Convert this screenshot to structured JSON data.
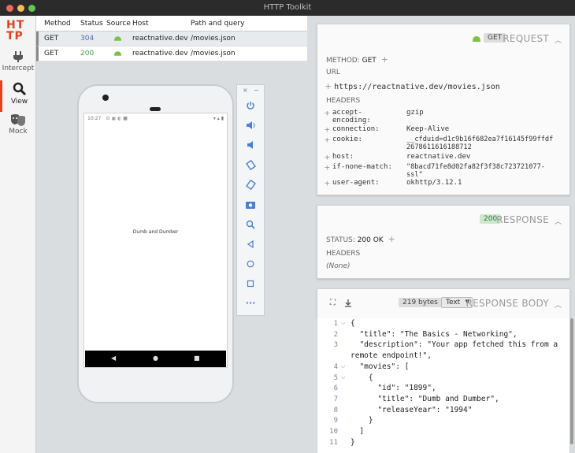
{
  "window": {
    "title": "HTTP Toolkit"
  },
  "sidebar": {
    "logo_line1": "HT",
    "logo_line2": "TP",
    "items": [
      {
        "label": "Intercept",
        "icon": "plug-icon"
      },
      {
        "label": "View",
        "icon": "search-icon"
      },
      {
        "label": "Mock",
        "icon": "theater-masks-icon"
      }
    ]
  },
  "request_list": {
    "columns": {
      "method": "Method",
      "status": "Status",
      "source": "Source",
      "host": "Host",
      "path": "Path and query"
    },
    "rows": [
      {
        "method": "GET",
        "status": "304",
        "host": "reactnative.dev",
        "path": "/movies.json"
      },
      {
        "method": "GET",
        "status": "200",
        "host": "reactnative.dev",
        "path": "/movies.json"
      }
    ]
  },
  "emulator": {
    "status_time": "10:27",
    "app_text": "Dumb and Dumber",
    "nav": {
      "back": "◀",
      "home": "●",
      "recent": "■"
    },
    "toolbar": {
      "close": "×",
      "minimize": "−",
      "more": "···"
    }
  },
  "request": {
    "method_badge": "GET",
    "title": "REQUEST",
    "method_label": "METHOD:",
    "method_value": "GET",
    "url_label": "URL",
    "url": "https://reactnative.dev/movies.json",
    "headers_label": "HEADERS",
    "headers": [
      {
        "key": "accept-",
        "key2": "encoding:",
        "value": "gzip",
        "value2": ""
      },
      {
        "key": "connection:",
        "key2": "",
        "value": "Keep-Alive",
        "value2": ""
      },
      {
        "key": "cookie:",
        "key2": "",
        "value": "__cfduid=d1c9b16f682ea7f16145f99ffdf",
        "value2": "2678611616188712"
      },
      {
        "key": "host:",
        "key2": "",
        "value": "reactnative.dev",
        "value2": ""
      },
      {
        "key": "if-none-match:",
        "key2": "",
        "value": "\"8bacd71fe8d02fa82f3f38c723721077-",
        "value2": "ssl\""
      },
      {
        "key": "user-agent:",
        "key2": "",
        "value": "okhttp/3.12.1",
        "value2": ""
      }
    ]
  },
  "response": {
    "status_badge": "200",
    "title": "RESPONSE",
    "status_label": "STATUS:",
    "status_value": "200 OK",
    "headers_label": "HEADERS",
    "headers_none": "(None)"
  },
  "response_body": {
    "size": "219 bytes",
    "format": "Text",
    "title": "RESPONSE BODY",
    "lines": [
      {
        "n": "1",
        "fold": "⌵",
        "text": "{"
      },
      {
        "n": "2",
        "fold": "",
        "text": "  \"title\": \"The Basics - Networking\","
      },
      {
        "n": "3",
        "fold": "",
        "text": "  \"description\": \"Your app fetched this from a"
      },
      {
        "n": "",
        "fold": "",
        "text": "remote endpoint!\","
      },
      {
        "n": "4",
        "fold": "⌵",
        "text": "  \"movies\": ["
      },
      {
        "n": "5",
        "fold": "⌵",
        "text": "    {"
      },
      {
        "n": "6",
        "fold": "",
        "text": "      \"id\": \"1899\","
      },
      {
        "n": "7",
        "fold": "",
        "text": "      \"title\": \"Dumb and Dumber\","
      },
      {
        "n": "8",
        "fold": "",
        "text": "      \"releaseYear\": \"1994\""
      },
      {
        "n": "9",
        "fold": "",
        "text": "    }"
      },
      {
        "n": "10",
        "fold": "",
        "text": "  ]"
      },
      {
        "n": "11",
        "fold": "",
        "text": "}"
      }
    ]
  },
  "colors": {
    "accent": "#e1421f",
    "status_304": "#4a6fb5",
    "status_200": "#47a04a",
    "android_green": "#7cc242"
  }
}
